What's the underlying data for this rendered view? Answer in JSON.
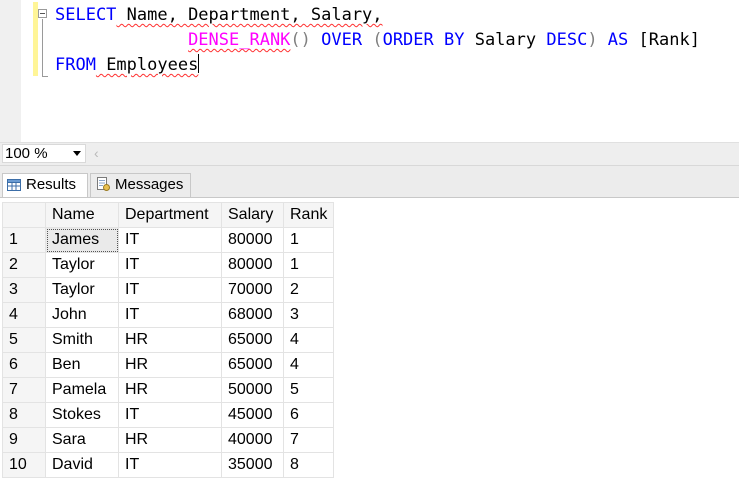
{
  "editor": {
    "line1": {
      "keyword": "SELECT",
      "text": " Name, Department, Salary,"
    },
    "line2": {
      "indent": "             ",
      "fn": "DENSE_RANK",
      "paren": "()",
      "over": " OVER ",
      "open": "(",
      "order_by": "ORDER BY",
      "col": " Salary ",
      "desc": "DESC",
      "close": ")",
      "as": " AS ",
      "alias": "[Rank]"
    },
    "line3": {
      "keyword": "FROM",
      "table": " Employees"
    }
  },
  "zoom": {
    "value": "100 %",
    "scroll_left_icon": "chevron-left-icon"
  },
  "tabs": [
    {
      "label": "Results",
      "icon": "grid-icon",
      "active": true
    },
    {
      "label": "Messages",
      "icon": "messages-icon",
      "active": false
    }
  ],
  "grid": {
    "columns": [
      "Name",
      "Department",
      "Salary",
      "Rank"
    ],
    "rows": [
      {
        "num": "1",
        "name": "James",
        "dept": "IT",
        "salary": "80000",
        "rank": "1"
      },
      {
        "num": "2",
        "name": "Taylor",
        "dept": "IT",
        "salary": "80000",
        "rank": "1"
      },
      {
        "num": "3",
        "name": "Taylor",
        "dept": "IT",
        "salary": "70000",
        "rank": "2"
      },
      {
        "num": "4",
        "name": "John",
        "dept": "IT",
        "salary": "68000",
        "rank": "3"
      },
      {
        "num": "5",
        "name": "Smith",
        "dept": "HR",
        "salary": "65000",
        "rank": "4"
      },
      {
        "num": "6",
        "name": "Ben",
        "dept": "HR",
        "salary": "65000",
        "rank": "4"
      },
      {
        "num": "7",
        "name": "Pamela",
        "dept": "HR",
        "salary": "50000",
        "rank": "5"
      },
      {
        "num": "8",
        "name": "Stokes",
        "dept": "IT",
        "salary": "45000",
        "rank": "6"
      },
      {
        "num": "9",
        "name": "Sara",
        "dept": "HR",
        "salary": "40000",
        "rank": "7"
      },
      {
        "num": "10",
        "name": "David",
        "dept": "IT",
        "salary": "35000",
        "rank": "8"
      }
    ]
  },
  "colors": {
    "keyword": "#0000ff",
    "function": "#ff00ff",
    "operator": "#808080",
    "change_bar": "#fff597"
  }
}
